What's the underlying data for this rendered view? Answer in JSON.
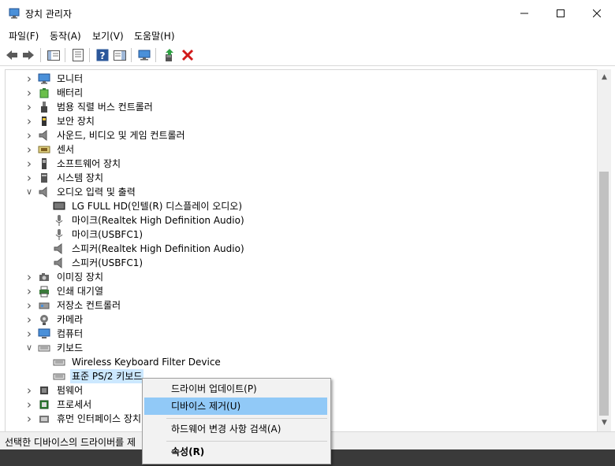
{
  "window": {
    "title": "장치 관리자"
  },
  "menubar": {
    "items": [
      "파일(F)",
      "동작(A)",
      "보기(V)",
      "도움말(H)"
    ]
  },
  "tree": [
    {
      "label": "모니터",
      "expanded": false,
      "level": 0,
      "icon": "monitor-icon"
    },
    {
      "label": "배터리",
      "expanded": false,
      "level": 0,
      "icon": "battery-icon"
    },
    {
      "label": "범용 직렬 버스 컨트롤러",
      "expanded": false,
      "level": 0,
      "icon": "usb-icon"
    },
    {
      "label": "보안 장치",
      "expanded": false,
      "level": 0,
      "icon": "security-icon"
    },
    {
      "label": "사운드, 비디오 및 게임 컨트롤러",
      "expanded": false,
      "level": 0,
      "icon": "speaker-icon"
    },
    {
      "label": "센서",
      "expanded": false,
      "level": 0,
      "icon": "sensor-icon"
    },
    {
      "label": "소프트웨어 장치",
      "expanded": false,
      "level": 0,
      "icon": "software-device-icon"
    },
    {
      "label": "시스템 장치",
      "expanded": false,
      "level": 0,
      "icon": "system-icon"
    },
    {
      "label": "오디오 입력 및 출력",
      "expanded": true,
      "level": 0,
      "icon": "speaker-icon"
    },
    {
      "label": "LG FULL HD(인텔(R) 디스플레이 오디오)",
      "level": 1,
      "icon": "display-audio-icon"
    },
    {
      "label": "마이크(Realtek High Definition Audio)",
      "level": 1,
      "icon": "microphone-icon"
    },
    {
      "label": "마이크(USBFC1)",
      "level": 1,
      "icon": "microphone-icon"
    },
    {
      "label": "스피커(Realtek High Definition Audio)",
      "level": 1,
      "icon": "speaker-icon"
    },
    {
      "label": "스피커(USBFC1)",
      "level": 1,
      "icon": "speaker-icon"
    },
    {
      "label": "이미징 장치",
      "expanded": false,
      "level": 0,
      "icon": "imaging-icon"
    },
    {
      "label": "인쇄 대기열",
      "expanded": false,
      "level": 0,
      "icon": "printer-icon"
    },
    {
      "label": "저장소 컨트롤러",
      "expanded": false,
      "level": 0,
      "icon": "storage-icon"
    },
    {
      "label": "카메라",
      "expanded": false,
      "level": 0,
      "icon": "camera-icon"
    },
    {
      "label": "컴퓨터",
      "expanded": false,
      "level": 0,
      "icon": "computer-icon"
    },
    {
      "label": "키보드",
      "expanded": true,
      "level": 0,
      "icon": "keyboard-icon"
    },
    {
      "label": "Wireless Keyboard Filter Device",
      "level": 1,
      "icon": "keyboard-icon"
    },
    {
      "label": "표준 PS/2 키보드",
      "level": 1,
      "icon": "keyboard-icon",
      "selected": true
    },
    {
      "label": "펌웨어",
      "expanded": false,
      "level": 0,
      "icon": "firmware-icon"
    },
    {
      "label": "프로세서",
      "expanded": false,
      "level": 0,
      "icon": "processor-icon"
    },
    {
      "label": "휴먼 인터페이스 장치",
      "expanded": false,
      "level": 0,
      "icon": "hid-icon"
    }
  ],
  "context_menu": {
    "items": [
      {
        "label": "드라이버 업데이트(P)",
        "highlighted": false,
        "bold": false
      },
      {
        "label": "디바이스 제거(U)",
        "highlighted": true,
        "bold": false
      },
      {
        "label": "하드웨어 변경 사항 검색(A)",
        "highlighted": false,
        "bold": false
      },
      {
        "label": "속성(R)",
        "highlighted": false,
        "bold": true
      }
    ]
  },
  "status": {
    "text": "선택한 디바이스의 드라이버를 제"
  },
  "colors": {
    "selection": "#cce8ff",
    "menu_highlight": "#91c9f7",
    "remove_red": "#d11a1a"
  }
}
